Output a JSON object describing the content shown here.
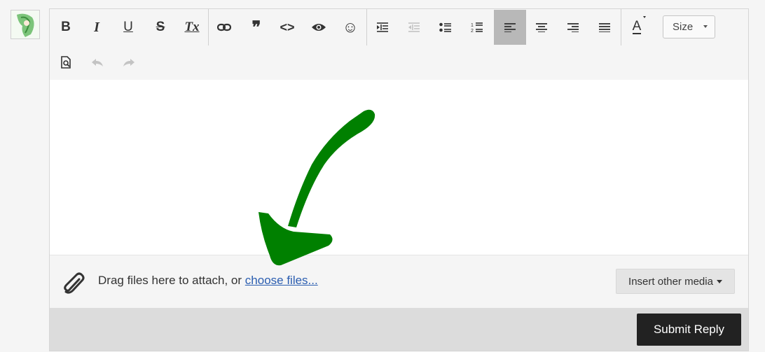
{
  "avatar": {
    "icon": "user-avatar-icon"
  },
  "toolbar": {
    "row1": [
      {
        "name": "bold-button",
        "icon": "bold-icon",
        "glyph": "B"
      },
      {
        "name": "italic-button",
        "icon": "italic-icon",
        "glyph": "I"
      },
      {
        "name": "underline-button",
        "icon": "underline-icon",
        "glyph": "U"
      },
      {
        "name": "strikethrough-button",
        "icon": "strikethrough-icon",
        "glyph": "S"
      },
      {
        "name": "remove-format-button",
        "icon": "clear-format-icon",
        "glyph": "Tx"
      },
      {
        "name": "link-button",
        "icon": "link-icon"
      },
      {
        "name": "quote-button",
        "icon": "quote-icon",
        "glyph": "❞"
      },
      {
        "name": "code-button",
        "icon": "code-icon",
        "glyph": "<>"
      },
      {
        "name": "spoiler-button",
        "icon": "eye-icon"
      },
      {
        "name": "emoji-button",
        "icon": "smiley-icon",
        "glyph": "☺"
      },
      {
        "name": "indent-button",
        "icon": "indent-icon"
      },
      {
        "name": "outdent-button",
        "icon": "outdent-icon",
        "disabled": true
      },
      {
        "name": "bullet-list-button",
        "icon": "bullet-list-icon"
      },
      {
        "name": "numbered-list-button",
        "icon": "numbered-list-icon"
      },
      {
        "name": "align-left-button",
        "icon": "align-left-icon",
        "active": true
      },
      {
        "name": "align-center-button",
        "icon": "align-center-icon"
      },
      {
        "name": "align-right-button",
        "icon": "align-right-icon"
      },
      {
        "name": "justify-button",
        "icon": "justify-icon"
      },
      {
        "name": "text-color-button",
        "icon": "text-color-icon",
        "glyph": "A"
      }
    ],
    "size_label": "Size",
    "row2": [
      {
        "name": "preview-button",
        "icon": "preview-icon"
      },
      {
        "name": "undo-button",
        "icon": "undo-icon",
        "disabled": true
      },
      {
        "name": "redo-button",
        "icon": "redo-icon",
        "disabled": true
      }
    ]
  },
  "attach": {
    "text": "Drag files here to attach, or ",
    "link": "choose files...",
    "insert_media_label": "Insert other media",
    "icon": "paperclip-icon"
  },
  "footer": {
    "submit_label": "Submit Reply"
  },
  "annotation": {
    "color": "#008000",
    "icon": "green-arrow-icon"
  }
}
